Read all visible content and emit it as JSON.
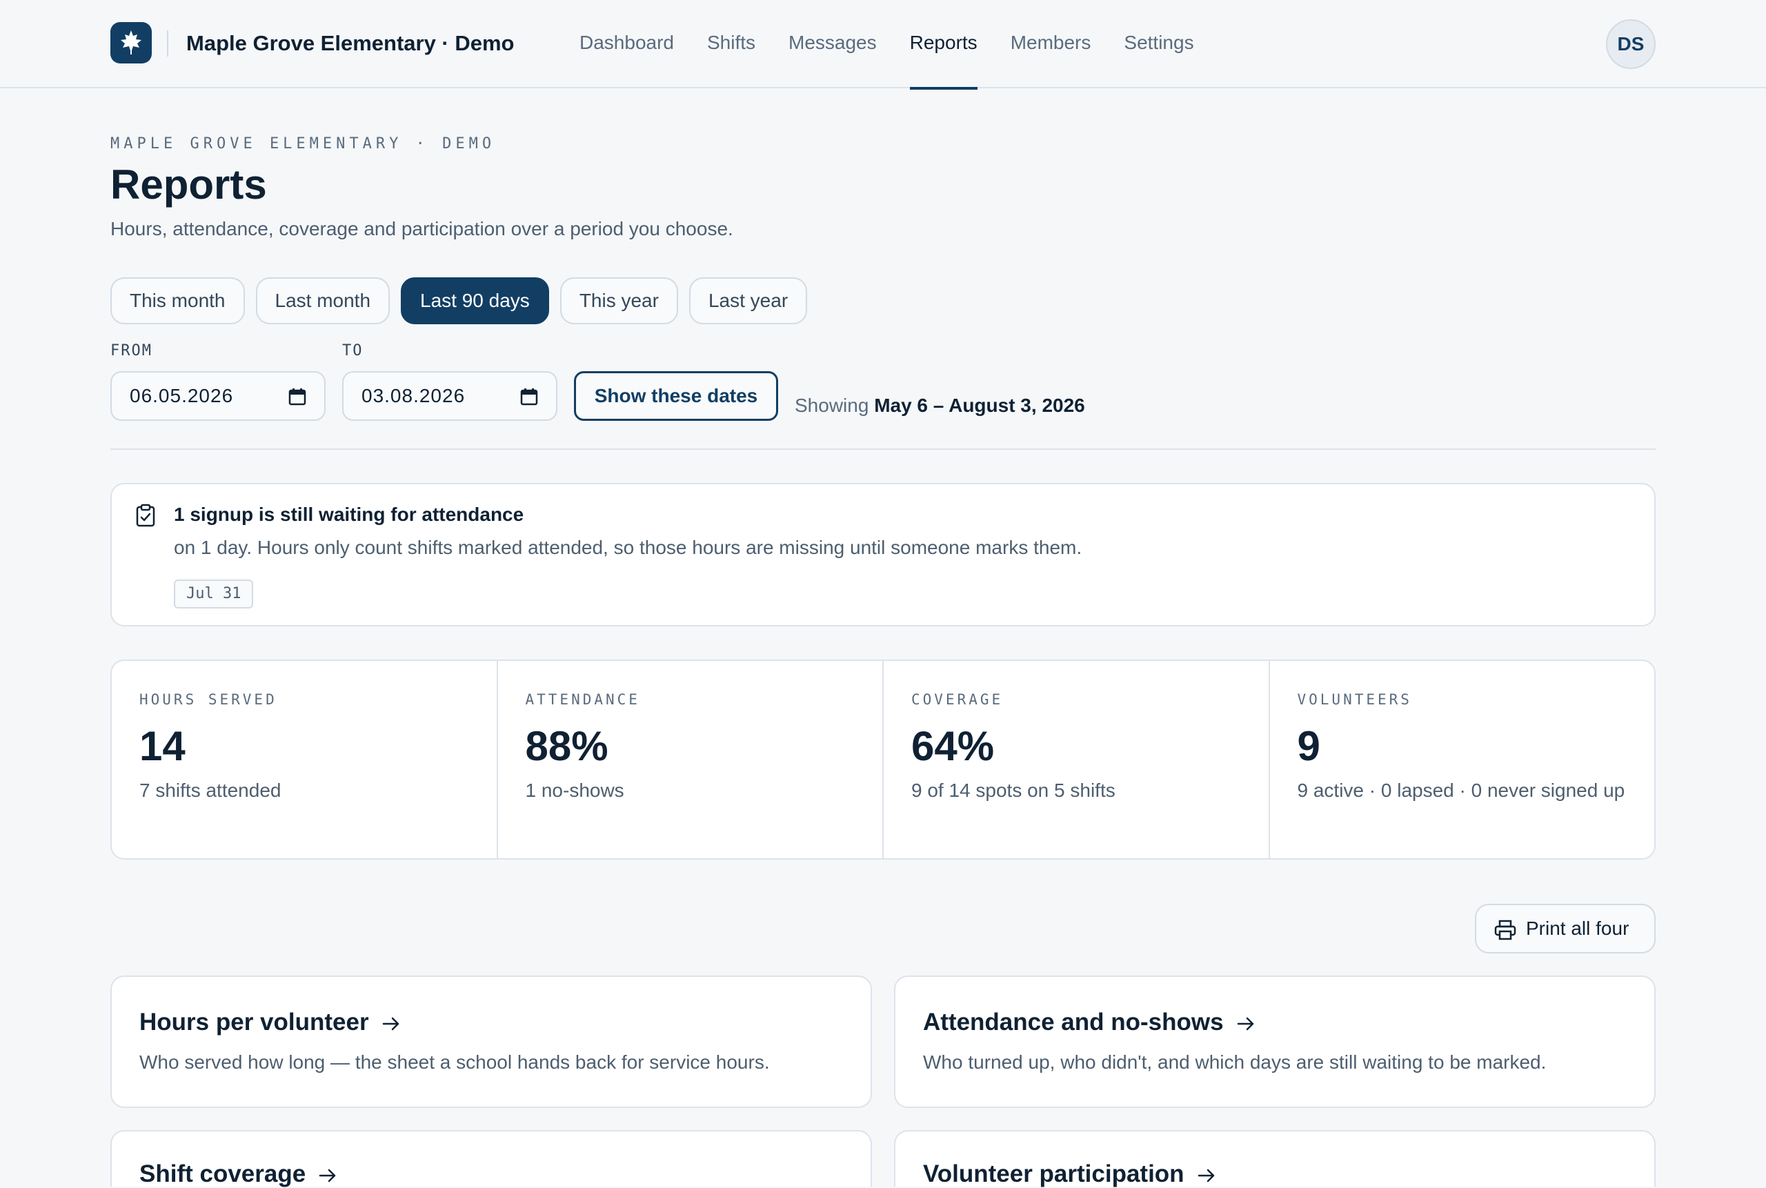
{
  "app": {
    "name": "Maple Grove Elementary · Demo",
    "logo_icon": "maple-leaf-icon",
    "avatar_initials": "DS"
  },
  "nav": {
    "items": [
      {
        "label": "Dashboard",
        "active": false
      },
      {
        "label": "Shifts",
        "active": false
      },
      {
        "label": "Messages",
        "active": false
      },
      {
        "label": "Reports",
        "active": true
      },
      {
        "label": "Members",
        "active": false
      },
      {
        "label": "Settings",
        "active": false
      }
    ]
  },
  "header": {
    "eyebrow": "MAPLE GROVE ELEMENTARY · DEMO",
    "title": "Reports",
    "subtitle": "Hours, attendance, coverage and participation over a period you choose."
  },
  "presets": [
    {
      "label": "This month",
      "selected": false
    },
    {
      "label": "Last month",
      "selected": false
    },
    {
      "label": "Last 90 days",
      "selected": true
    },
    {
      "label": "This year",
      "selected": false
    },
    {
      "label": "Last year",
      "selected": false
    }
  ],
  "range": {
    "from_label": "FROM",
    "from_value": "06.05.2026",
    "to_label": "TO",
    "to_value": "03.08.2026",
    "apply_label": "Show these dates",
    "showing_prefix": "Showing",
    "showing_value": "May 6 – August 3, 2026"
  },
  "notice": {
    "icon": "clipboard-check-icon",
    "title": "1 signup is still waiting for attendance",
    "text": "on 1 day. Hours only count shifts marked attended, so those hours are missing until someone marks them.",
    "dates": [
      "Jul 31"
    ]
  },
  "stats": [
    {
      "label": "HOURS SERVED",
      "value": "14",
      "detail": "7 shifts attended"
    },
    {
      "label": "ATTENDANCE",
      "value": "88%",
      "detail": "1 no-shows"
    },
    {
      "label": "COVERAGE",
      "value": "64%",
      "detail": "9 of 14 spots on 5 shifts"
    },
    {
      "label": "VOLUNTEERS",
      "value": "9",
      "detail": "9 active · 0 lapsed · 0 never signed up"
    }
  ],
  "print": {
    "label": "Print all four",
    "icon": "printer-icon"
  },
  "reports": [
    {
      "title": "Hours per volunteer",
      "description": "Who served how long — the sheet a school hands back for service hours."
    },
    {
      "title": "Attendance and no-shows",
      "description": "Who turned up, who didn't, and which days are still waiting to be marked."
    },
    {
      "title": "Shift coverage",
      "description": ""
    },
    {
      "title": "Volunteer participation",
      "description": ""
    }
  ],
  "colors": {
    "brand": "#123e64",
    "background": "#f5f7f9",
    "text": "#0f2133",
    "muted": "#4d5e6f"
  }
}
